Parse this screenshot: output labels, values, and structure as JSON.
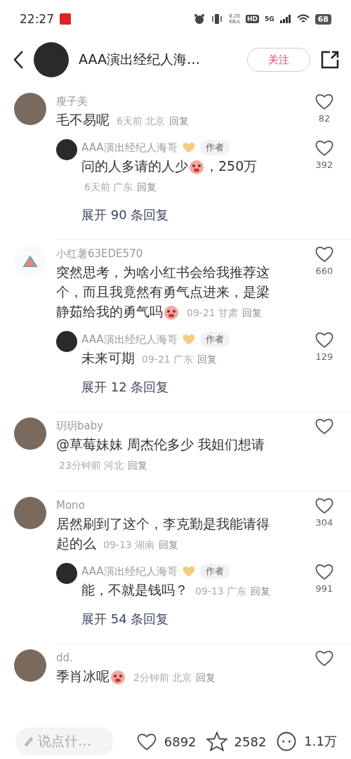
{
  "status_bar": {
    "time": "22:27",
    "speed_value": "8.20",
    "speed_unit": "KB/s",
    "hd_badge": "HD",
    "network": "5G",
    "battery": "68"
  },
  "header": {
    "title": "AAA演出经纪人海…",
    "follow_button": "关注"
  },
  "comments": [
    {
      "user": "瘦子美",
      "avatar": {
        "kind": "photo"
      },
      "content": [
        {
          "kind": "text",
          "text": "毛不易呢"
        }
      ],
      "time": "6天前",
      "location": "北京",
      "reply_label": "回复",
      "likes": "82",
      "replies": [
        {
          "user": "AAA演出经纪人海哥",
          "author_badge": "作者",
          "content": [
            {
              "kind": "text",
              "text": "问的人多请的人少"
            },
            {
              "kind": "sticker"
            },
            {
              "kind": "text",
              "text": "，250万"
            }
          ],
          "time": "6天前",
          "location": "广东",
          "reply_label": "回复",
          "likes": "392"
        }
      ],
      "expand_label": "展开 90 条回复"
    },
    {
      "user": "小红薯63EDE570",
      "avatar": {
        "kind": "watermelon"
      },
      "content": [
        {
          "kind": "text",
          "text": "突然思考，为啥小红书会给我推荐这个，而且我竟然有勇气点进来，是梁静茹给我的勇气吗"
        },
        {
          "kind": "sticker"
        }
      ],
      "time": "09-21",
      "location": "甘肃",
      "reply_label": "回复",
      "likes": "660",
      "replies": [
        {
          "user": "AAA演出经纪人海哥",
          "author_badge": "作者",
          "content": [
            {
              "kind": "text",
              "text": "未来可期"
            }
          ],
          "time": "09-21",
          "location": "广东",
          "reply_label": "回复",
          "likes": "129"
        }
      ],
      "expand_label": "展开 12 条回复"
    },
    {
      "user": "玥玥baby",
      "avatar": {
        "kind": "photo"
      },
      "content": [
        {
          "kind": "text",
          "text": "@草莓妹妹  周杰伦多少 我姐们想请"
        }
      ],
      "time": "23分钟前",
      "location": "河北",
      "reply_label": "回复"
    },
    {
      "user": "Mono",
      "avatar": {
        "kind": "photo"
      },
      "content": [
        {
          "kind": "text",
          "text": "居然刷到了这个，李克勤是我能请得起的么"
        }
      ],
      "time": "09-13",
      "location": "湖南",
      "reply_label": "回复",
      "likes": "304",
      "replies": [
        {
          "user": "AAA演出经纪人海哥",
          "author_badge": "作者",
          "content": [
            {
              "kind": "text",
              "text": "能，不就是钱吗？"
            }
          ],
          "time": "09-13",
          "location": "广东",
          "reply_label": "回复",
          "likes": "991"
        }
      ],
      "expand_label": "展开 54 条回复"
    },
    {
      "user": "dd.",
      "avatar": {
        "kind": "photo"
      },
      "content": [
        {
          "kind": "text",
          "text": "季肖冰呢"
        },
        {
          "kind": "sticker"
        }
      ],
      "time": "2分钟前",
      "location": "北京",
      "reply_label": "回复"
    }
  ],
  "bottom_bar": {
    "input_placeholder": "说点什…",
    "likes": "6892",
    "stars": "2582",
    "comments": "1.1万"
  }
}
